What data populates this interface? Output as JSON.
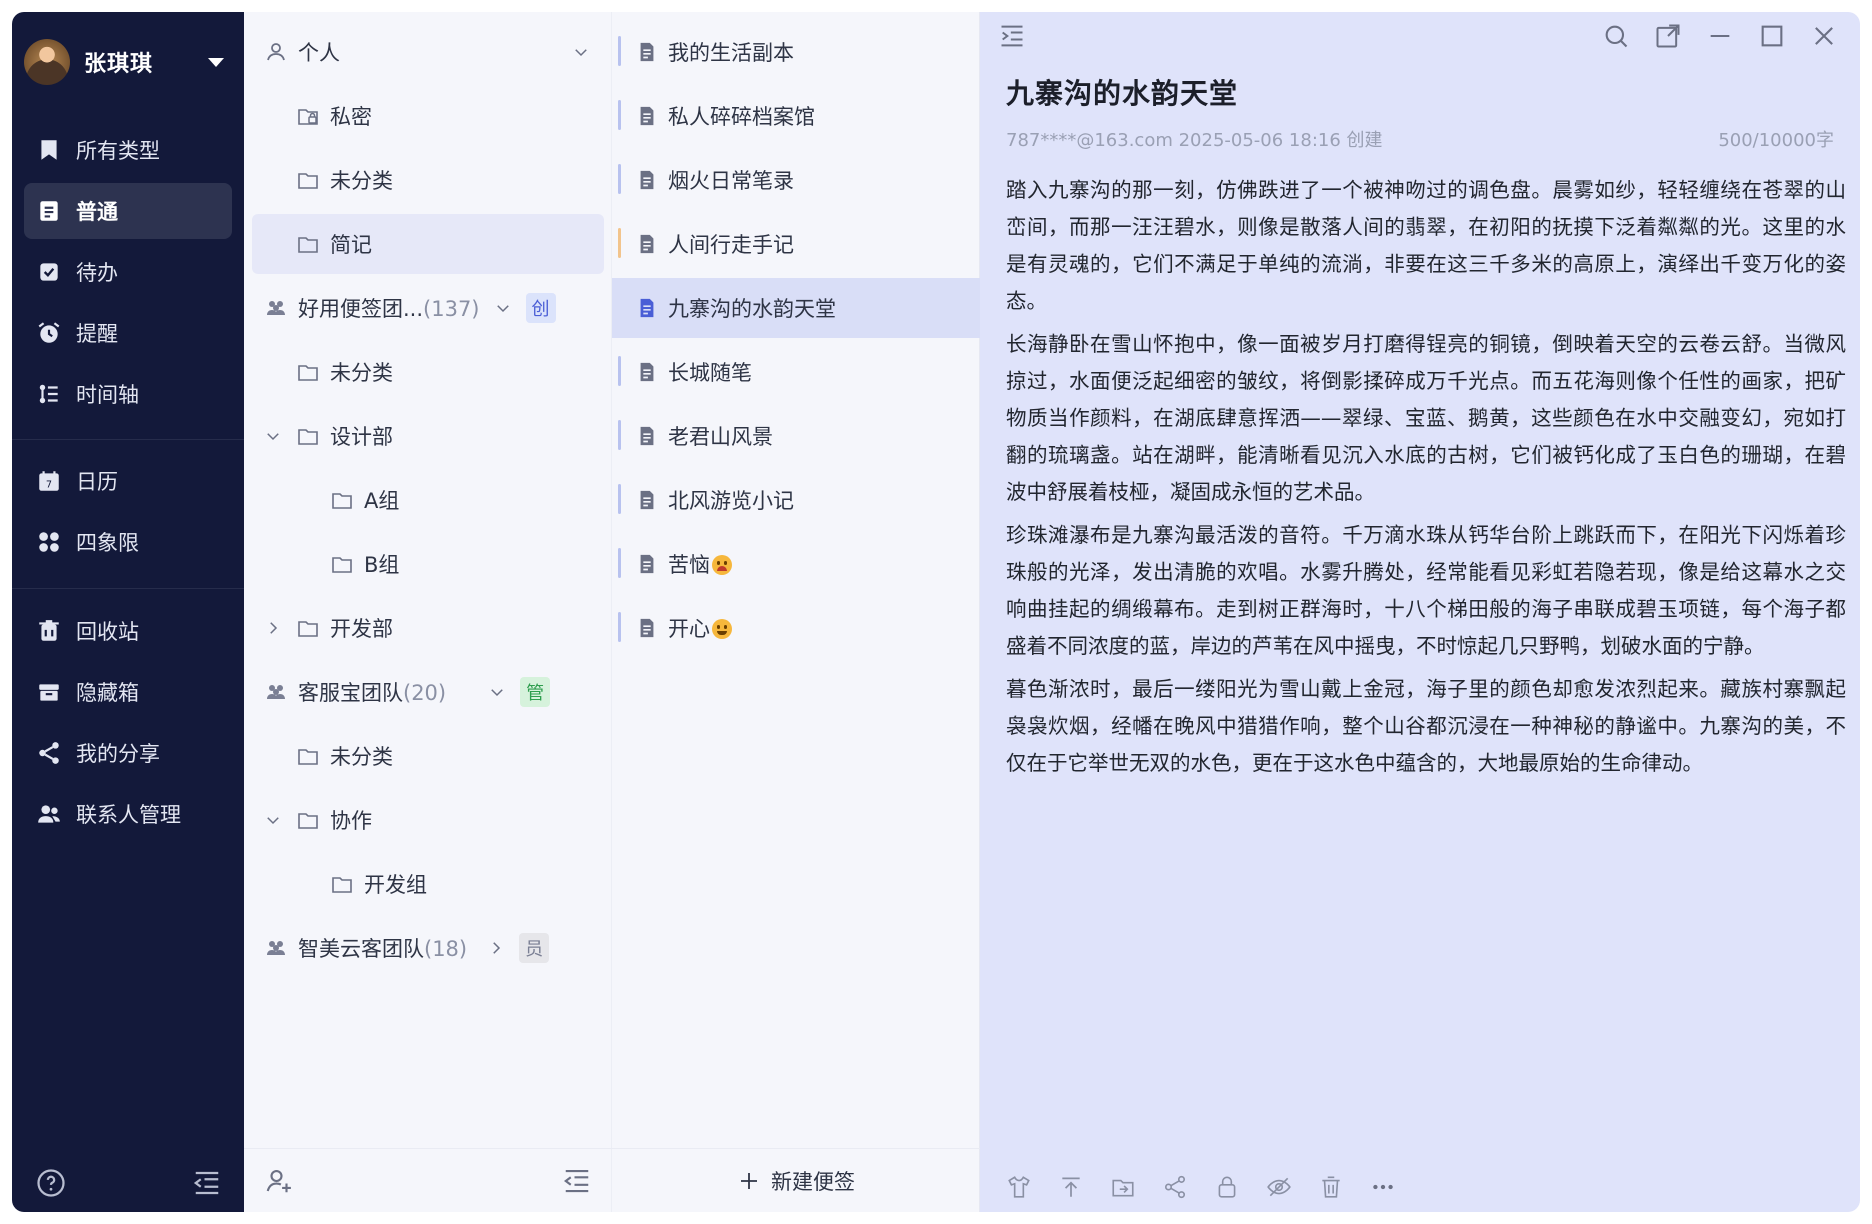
{
  "user": {
    "name": "张琪琪"
  },
  "nav": {
    "group1": [
      "所有类型",
      "普通",
      "待办",
      "提醒",
      "时间轴"
    ],
    "group2": [
      "日历",
      "四象限"
    ],
    "group3": [
      "回收站",
      "隐藏箱",
      "我的分享",
      "联系人管理"
    ]
  },
  "folders": {
    "personal": "个人",
    "private": "私密",
    "uncat1": "未分类",
    "jianji": "简记",
    "team1": "好用便签团...",
    "team1_count": "(137)",
    "team1_badge": "创",
    "uncat2": "未分类",
    "design": "设计部",
    "groupA": "A组",
    "groupB": "B组",
    "dev": "开发部",
    "team2": "客服宝团队",
    "team2_count": "(20)",
    "team2_badge": "管",
    "uncat3": "未分类",
    "collab": "协作",
    "devgroup": "开发组",
    "team3": "智美云客团队",
    "team3_count": "(18)",
    "team3_badge": "员"
  },
  "notes": {
    "items": [
      "我的生活副本",
      "私人碎碎档案馆",
      "烟火日常笔录",
      "人间行走手记",
      "九寨沟的水韵天堂",
      "长城随笔",
      "老君山风景",
      "北风游览小记",
      "苦恼",
      "开心"
    ],
    "new_label": "新建便签"
  },
  "editor": {
    "title": "九寨沟的水韵天堂",
    "meta": "787****@163.com  2025-05-06 18:16  创建",
    "count": "500/10000字",
    "paragraphs": [
      "踏入九寨沟的那一刻，仿佛跌进了一个被神吻过的调色盘。晨雾如纱，轻轻缠绕在苍翠的山峦间，而那一汪汪碧水，则像是散落人间的翡翠，在初阳的抚摸下泛着粼粼的光。这里的水是有灵魂的，它们不满足于单纯的流淌，非要在这三千多米的高原上，演绎出千变万化的姿态。",
      "长海静卧在雪山怀抱中，像一面被岁月打磨得锃亮的铜镜，倒映着天空的云卷云舒。当微风掠过，水面便泛起细密的皱纹，将倒影揉碎成万千光点。而五花海则像个任性的画家，把矿物质当作颜料，在湖底肆意挥洒——翠绿、宝蓝、鹅黄，这些颜色在水中交融变幻，宛如打翻的琉璃盏。站在湖畔，能清晰看见沉入水底的古树，它们被钙化成了玉白色的珊瑚，在碧波中舒展着枝桠，凝固成永恒的艺术品。",
      "珍珠滩瀑布是九寨沟最活泼的音符。千万滴水珠从钙华台阶上跳跃而下，在阳光下闪烁着珍珠般的光泽，发出清脆的欢唱。水雾升腾处，经常能看见彩虹若隐若现，像是给这幕水之交响曲挂起的绸缎幕布。走到树正群海时，十八个梯田般的海子串联成碧玉项链，每个海子都盛着不同浓度的蓝，岸边的芦苇在风中摇曳，不时惊起几只野鸭，划破水面的宁静。",
      "暮色渐浓时，最后一缕阳光为雪山戴上金冠，海子里的颜色却愈发浓烈起来。藏族村寨飘起袅袅炊烟，经幡在晚风中猎猎作响，整个山谷都沉浸在一种神秘的静谧中。九寨沟的美，不仅在于它举世无双的水色，更在于这水色中蕴含的，大地最原始的生命律动。"
    ]
  },
  "colors": {
    "sidebar_bg": "#13193a",
    "editor_bg": "#dfe3fa",
    "selected_note": "#d9def7",
    "accent": "#4a5ed6"
  }
}
